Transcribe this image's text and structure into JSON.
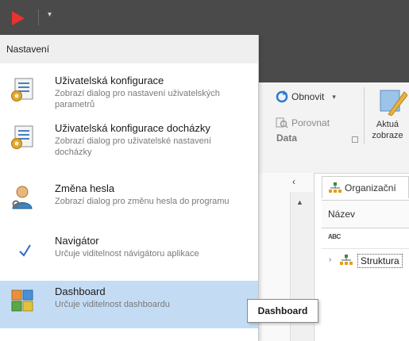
{
  "titlebar": {
    "app_icon": "play-icon",
    "quick_access_dropdown": "▾"
  },
  "ribbon": {
    "refresh_label": "Obnovit",
    "compare_label": "Porovnat",
    "group_label": "Data",
    "big_button_label_line1": "Aktuá",
    "big_button_label_line2": "zobraze"
  },
  "panel": {
    "collapse_glyph": "‹"
  },
  "document": {
    "tab_label": "Organizační",
    "column_header": "Název",
    "filter_icon_text": "ABC",
    "tree_row_label": "Struktura"
  },
  "menu": {
    "header": "Nastavení",
    "items": [
      {
        "title": "Uživatelská konfigurace",
        "description": "Zobrazí dialog pro nastavení uživatelských parametrů",
        "icon": "user-config-icon"
      },
      {
        "title": "Uživatelská konfigurace docházky",
        "description": "Zobrazí dialog pro uživatelské nastavení docházky",
        "icon": "attendance-config-icon"
      },
      {
        "title": "Změna hesla",
        "description": "Zobrazí dialog pro změnu hesla do programu",
        "icon": "user-key-icon"
      },
      {
        "title": "Navigátor",
        "description": "Určuje viditelnost návigátoru aplikace",
        "icon": "checkmark-icon"
      },
      {
        "title": "Dashboard",
        "description": "Určuje viditelnost dashboardu",
        "icon": "dashboard-icon"
      }
    ]
  },
  "tooltip": {
    "text": "Dashboard"
  },
  "colors": {
    "titlebar": "#4a4a4a",
    "highlight": "#c3dcf4",
    "accent_red": "#e8322e",
    "check_blue": "#2b6cc4"
  }
}
